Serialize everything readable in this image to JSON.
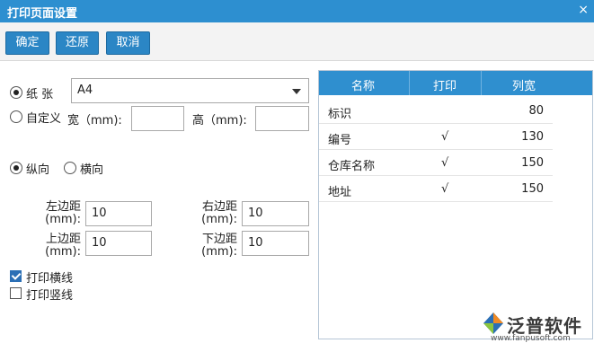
{
  "window": {
    "title": "打印页面设置",
    "close_glyph": "×"
  },
  "toolbar": {
    "confirm_label": "确定",
    "restore_label": "还原",
    "cancel_label": "取消"
  },
  "paper": {
    "paper_label": "纸 张",
    "paper_value": "A4",
    "custom_label": "自定义",
    "width_label": "宽（mm):",
    "height_label": "高（mm):",
    "width_value": "",
    "height_value": ""
  },
  "orientation": {
    "portrait_label": "纵向",
    "landscape_label": "横向"
  },
  "margins": {
    "left_label": "左边距\n(mm):",
    "left_value": "10",
    "right_label": "右边距\n(mm):",
    "right_value": "10",
    "top_label": "上边距\n(mm):",
    "top_value": "10",
    "bottom_label": "下边距\n(mm):",
    "bottom_value": "10"
  },
  "options": {
    "horizontal_lines_label": "打印横线",
    "vertical_lines_label": "打印竖线"
  },
  "grid": {
    "headers": [
      "名称",
      "打印",
      "列宽"
    ],
    "rows": [
      {
        "name": "标识",
        "print": "",
        "width": "80"
      },
      {
        "name": "编号",
        "print": "√",
        "width": "130"
      },
      {
        "name": "仓库名称",
        "print": "√",
        "width": "150"
      },
      {
        "name": "地址",
        "print": "√",
        "width": "150"
      }
    ]
  },
  "watermark": {
    "brand": "泛普软件",
    "url": "www.fanpusoft.com"
  },
  "colors": {
    "accent": "#2d8fd0",
    "button": "#2b86c5",
    "logo_orange": "#f08a24",
    "logo_blue": "#2b6fb5"
  }
}
